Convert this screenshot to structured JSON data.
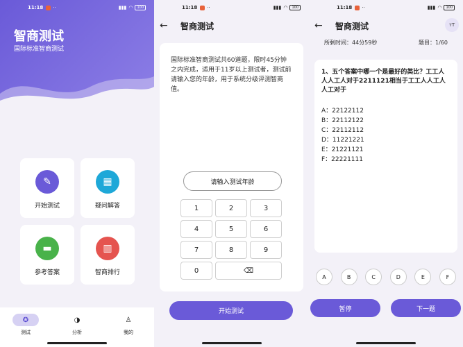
{
  "status": {
    "time": "11:18",
    "battery": "100"
  },
  "home": {
    "title": "智商测试",
    "subtitle": "国际标准智商测试",
    "cards": [
      {
        "label": "开始测试",
        "icon": "pencil-icon",
        "color": "#6a5ad8"
      },
      {
        "label": "疑问解答",
        "icon": "calendar-icon",
        "color": "#1ea8d8"
      },
      {
        "label": "参考答案",
        "icon": "chat-icon",
        "color": "#49b24a"
      },
      {
        "label": "智商排行",
        "icon": "bar-chart-icon",
        "color": "#e5544f"
      }
    ],
    "tabs": [
      {
        "label": "测试",
        "icon": "brain-icon"
      },
      {
        "label": "分析",
        "icon": "chart-icon"
      },
      {
        "label": "我的",
        "icon": "person-icon"
      }
    ]
  },
  "intro": {
    "title": "智商测试",
    "text": "国际标准智商测试共60道题，限时45分钟之内完成，适用于11岁以上测试者，测试前请输入您的年龄，用于系统分级评测智商值。",
    "age_placeholder": "请输入测试年龄",
    "keys": [
      "1",
      "2",
      "3",
      "4",
      "5",
      "6",
      "7",
      "8",
      "9",
      "0"
    ],
    "start_label": "开始测试"
  },
  "quiz": {
    "title": "智商测试",
    "badge": "тT",
    "time_left": "所剩时间：44分59秒",
    "progress": "题目：1/60",
    "question": "1、五个答案中哪一个是最好的类比？工工人人人工人对于2211121相当于工工人人工人人工对于",
    "options": [
      "A：22122112",
      "B：22112122",
      "C：22112112",
      "D：11221221",
      "E：21221121",
      "F：22221111"
    ],
    "answer_buttons": [
      "A",
      "B",
      "C",
      "D",
      "E",
      "F"
    ],
    "pause_label": "暂停",
    "next_label": "下一题"
  },
  "colors": {
    "accent": "#6a5ad8"
  }
}
